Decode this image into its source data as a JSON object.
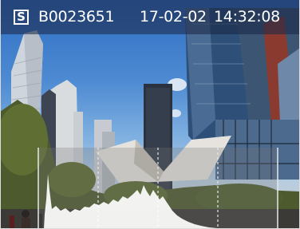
{
  "overlay": {
    "badge": "S",
    "frame_id": "B0023651",
    "date": "17-02-02",
    "time": "14:32:08"
  },
  "colors": {
    "sky": "#3a7bcd",
    "overlay_bar": "#1c2846",
    "histogram_fill": "#ffffff"
  },
  "icons": [
    "s-mode-icon"
  ]
}
